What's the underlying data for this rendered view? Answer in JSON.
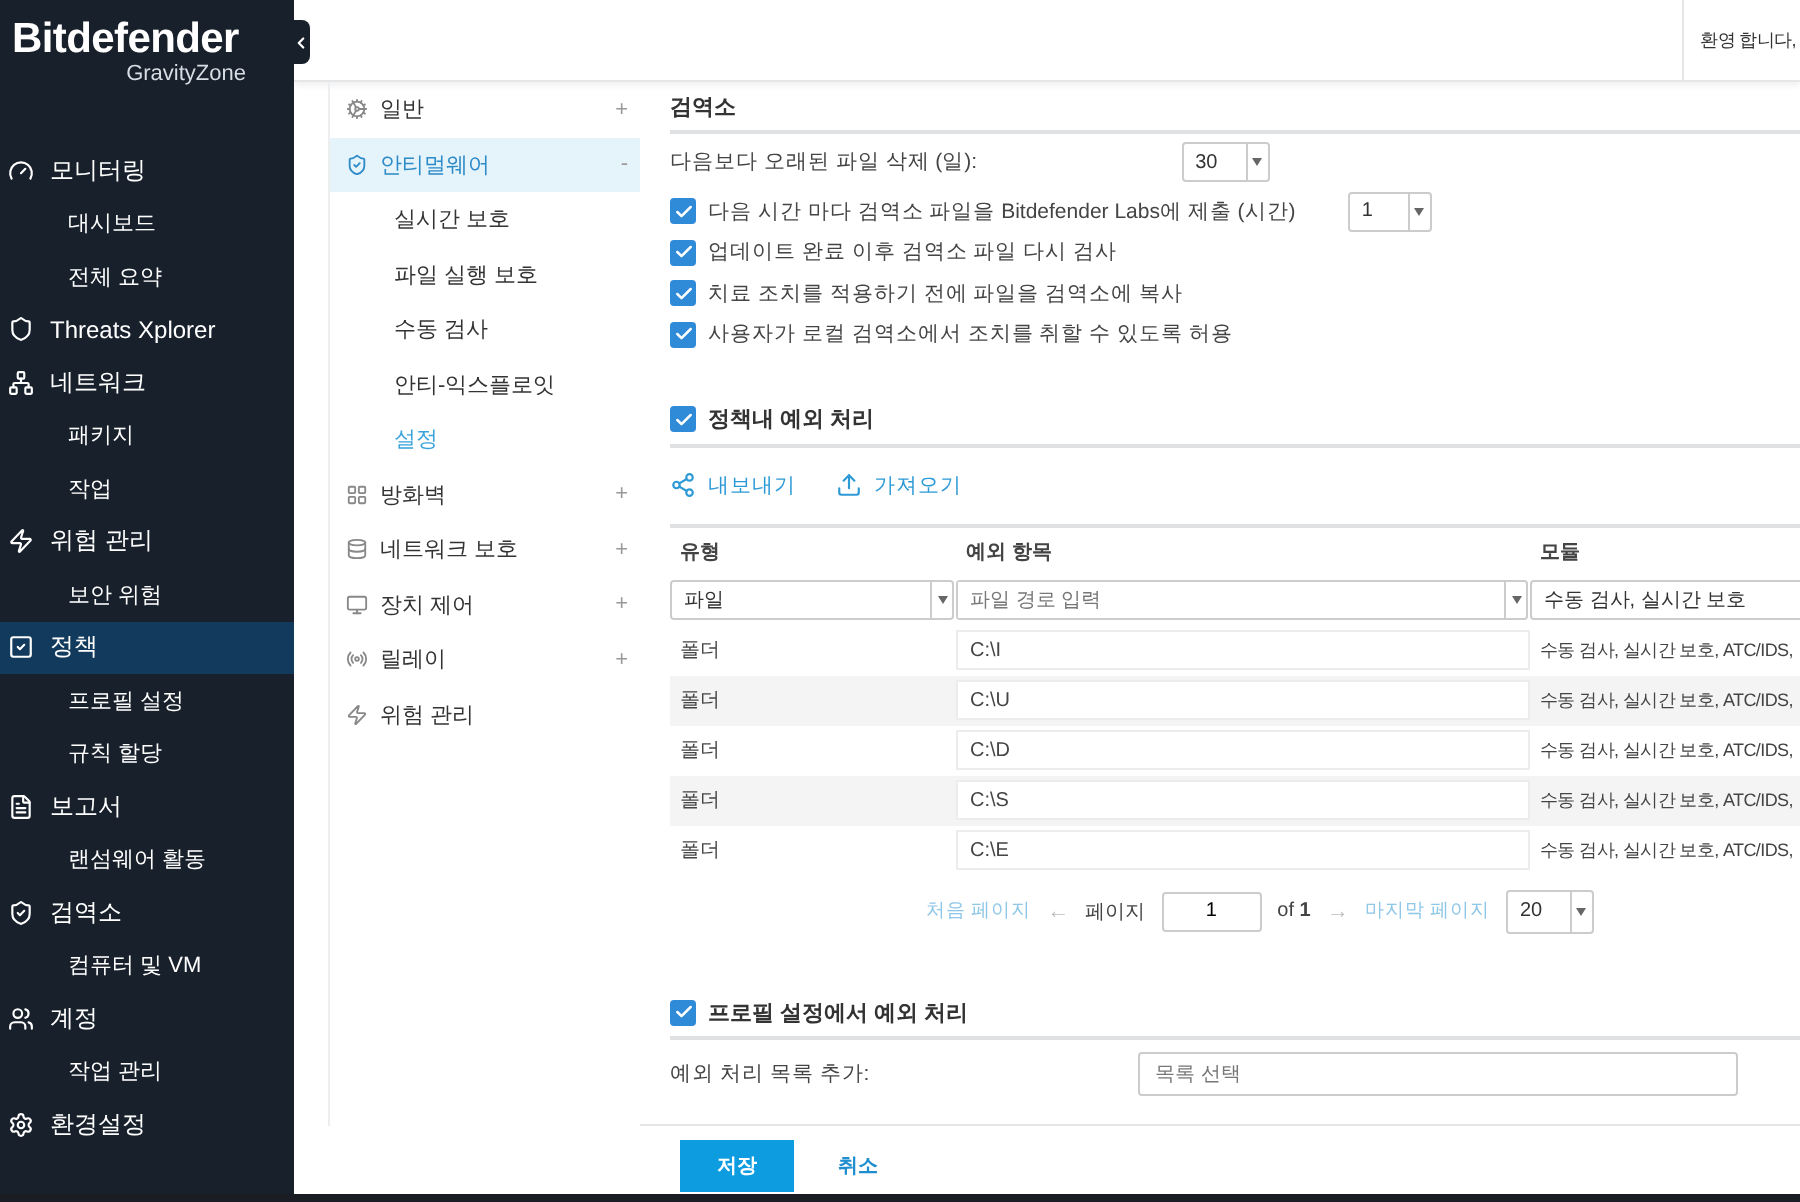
{
  "logo": {
    "name": "Bitdefender",
    "product": "GravityZone"
  },
  "sidebar": {
    "items": [
      {
        "label": "모니터링",
        "selected": false,
        "children": [
          {
            "label": "대시보드",
            "selected": false
          },
          {
            "label": "전체 요약",
            "selected": false
          }
        ]
      },
      {
        "label": "Threats Xplorer",
        "selected": false
      },
      {
        "label": "네트워크",
        "selected": false,
        "children": [
          {
            "label": "패키지",
            "selected": false
          },
          {
            "label": "작업",
            "selected": false
          }
        ]
      },
      {
        "label": "위험 관리",
        "selected": false,
        "children": [
          {
            "label": "보안 위험",
            "selected": false
          }
        ]
      },
      {
        "label": "정책",
        "selected": true,
        "children": [
          {
            "label": "프로필 설정",
            "selected": false
          },
          {
            "label": "규칙 할당",
            "selected": false
          }
        ]
      },
      {
        "label": "보고서",
        "selected": false,
        "children": [
          {
            "label": "랜섬웨어 활동",
            "selected": false
          }
        ]
      },
      {
        "label": "검역소",
        "selected": false,
        "children": [
          {
            "label": "컴퓨터 및 VM",
            "selected": false
          }
        ]
      },
      {
        "label": "계정",
        "selected": false,
        "children": [
          {
            "label": "작업 관리",
            "selected": false
          }
        ]
      },
      {
        "label": "환경설정",
        "selected": false
      }
    ]
  },
  "header": {
    "greeting": "환영 합니다,"
  },
  "policy_menu": {
    "items": [
      {
        "label": "일반",
        "toggle": "+",
        "selected": false
      },
      {
        "label": "안티멀웨어",
        "toggle": "-",
        "selected": true,
        "children": [
          {
            "label": "실시간 보호",
            "selected": false
          },
          {
            "label": "파일 실행 보호",
            "selected": false
          },
          {
            "label": "수동 검사",
            "selected": false
          },
          {
            "label": "안티-익스플로잇",
            "selected": false
          },
          {
            "label": "설정",
            "selected": true
          }
        ]
      },
      {
        "label": "방화벽",
        "toggle": "+",
        "selected": false
      },
      {
        "label": "네트워크 보호",
        "toggle": "+",
        "selected": false
      },
      {
        "label": "장치 제어",
        "toggle": "+",
        "selected": false
      },
      {
        "label": "릴레이",
        "toggle": "+",
        "selected": false
      },
      {
        "label": "위험 관리",
        "selected": false
      }
    ]
  },
  "quarantine": {
    "title": "검역소",
    "delete_older": {
      "label": "다음보다 오래된 파일 삭제 (일):",
      "value": "30"
    },
    "options": [
      {
        "label": "다음 시간 마다 검역소 파일을 Bitdefender Labs에 제출 (시간)",
        "checked": true,
        "value": "1"
      },
      {
        "label": "업데이트 완료 이후 검역소 파일 다시 검사",
        "checked": true
      },
      {
        "label": "치료 조치를 적용하기 전에 파일을 검역소에 복사",
        "checked": true
      },
      {
        "label": "사용자가 로컬 검역소에서 조치를 취할 수 있도록 허용",
        "checked": true
      }
    ]
  },
  "exclusions": {
    "title": "정책내 예외 처리",
    "checked": true,
    "actions": [
      "내보내기",
      "가져오기"
    ],
    "table": {
      "columns": [
        "유형",
        "예외 항목",
        "모듈"
      ],
      "filter": {
        "type": "파일",
        "path_placeholder": "파일 경로 입력",
        "modules": "수동 검사, 실시간 보호"
      },
      "rows": [
        {
          "type": "폴더",
          "path": "C:\\I",
          "modules": "수동 검사, 실시간 보호, ATC/IDS,"
        },
        {
          "type": "폴더",
          "path": "C:\\U",
          "modules": "수동 검사, 실시간 보호, ATC/IDS,"
        },
        {
          "type": "폴더",
          "path": "C:\\D",
          "modules": "수동 검사, 실시간 보호, ATC/IDS,"
        },
        {
          "type": "폴더",
          "path": "C:\\S",
          "modules": "수동 검사, 실시간 보호, ATC/IDS,"
        },
        {
          "type": "폴더",
          "path": "C:\\E",
          "modules": "수동 검사, 실시간 보호, ATC/IDS,"
        }
      ]
    },
    "pagination": {
      "first": "처음 페이지",
      "prev": "←",
      "page_label": "페이지",
      "page": "1",
      "of": "of **1**",
      "next": "→",
      "last": "마지막 페이지",
      "page_size": "20"
    }
  },
  "profile_exclusions": {
    "title": "프로필 설정에서 예외 처리",
    "checked": true,
    "add_label": "예외 처리 목록 추가:",
    "list_placeholder": "목록 선택"
  },
  "footer": {
    "save": "저장",
    "cancel": "취소"
  }
}
